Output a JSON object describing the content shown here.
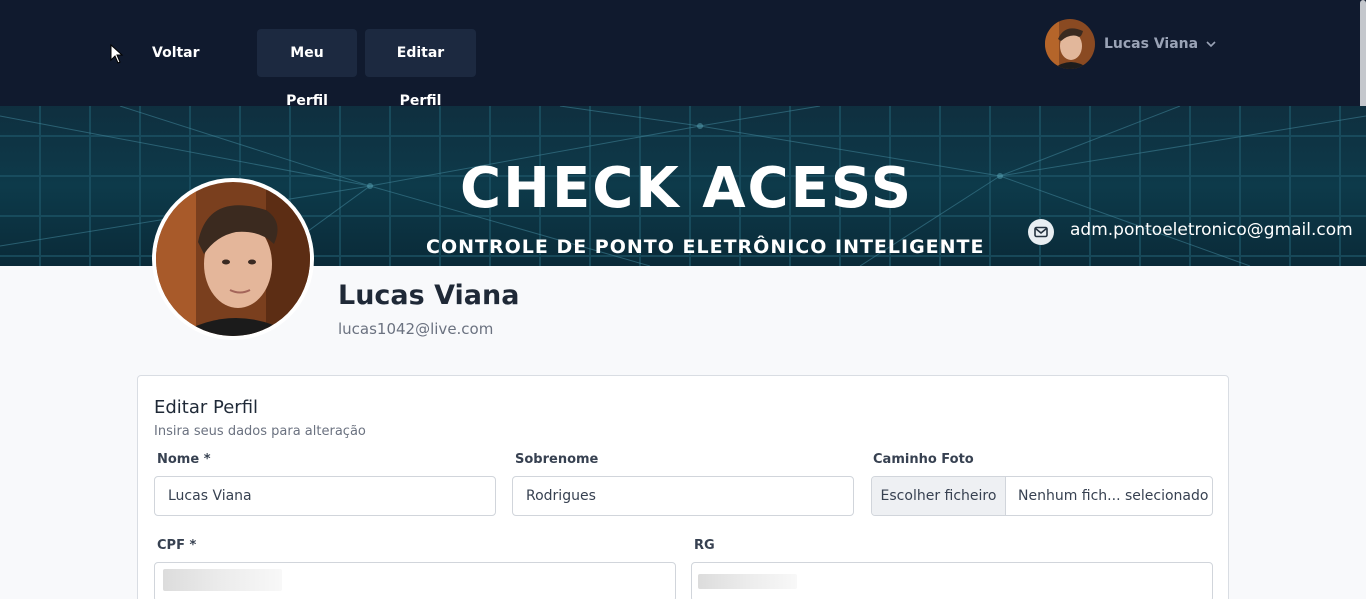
{
  "nav": {
    "back_label": "Voltar",
    "my_profile_label": "Meu Perfil",
    "edit_profile_label": "Editar Perfil",
    "user_name": "Lucas Viana",
    "user_menu_icon": "chevron-down-icon"
  },
  "banner": {
    "title": "CHECK ACESS",
    "subtitle": "CONTROLE DE PONTO ELETRÔNICO INTELIGENTE",
    "email": "adm.pontoeletronico@gmail.com",
    "email_icon": "mail-icon"
  },
  "profile": {
    "name": "Lucas Viana",
    "email": "lucas1042@live.com"
  },
  "form": {
    "title": "Editar Perfil",
    "subtitle": "Insira seus dados para alteração",
    "nome_label": "Nome *",
    "nome_value": "Lucas Viana",
    "sobrenome_label": "Sobrenome",
    "sobrenome_value": "Rodrigues",
    "foto_label": "Caminho Foto",
    "foto_button": "Escolher ficheiro",
    "foto_status": "Nenhum fich... selecionado",
    "cpf_label": "CPF *",
    "rg_label": "RG"
  },
  "colors": {
    "nav_bg": "#101a2e",
    "nav_button_bg": "#1c2940",
    "banner_bg": "#0d3a4a",
    "page_bg": "#f8f9fb"
  }
}
